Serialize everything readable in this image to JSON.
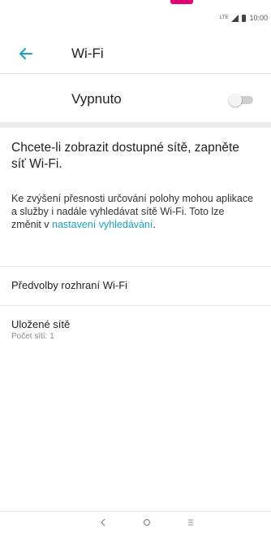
{
  "status_bar": {
    "time": "10:00",
    "network_label": "LTE"
  },
  "toolbar": {
    "title": "Wi-Fi"
  },
  "wifi_toggle": {
    "label": "Vypnuto",
    "state": "off"
  },
  "content": {
    "prompt": "Chcete-li zobrazit dostupné sítě, zapněte síť Wi-Fi.",
    "info_text": "Ke zvýšení přesnosti určování polohy mohou aplikace a služby i nadále vyhledávat sítě Wi-Fi. Toto lze změnit v ",
    "info_link": "nastavení vyhledávání",
    "info_end": "."
  },
  "menu": {
    "preferences": "Předvolby rozhraní Wi-Fi",
    "saved_networks": "Uložené sítě",
    "saved_count": "Počet sítí: 1"
  },
  "colors": {
    "accent": "#1aa3c8",
    "brand": "#e20074"
  },
  "icons": {
    "back": "arrow-left",
    "nav_back": "chevron-left",
    "nav_home": "circle",
    "nav_menu": "menu-lines"
  }
}
